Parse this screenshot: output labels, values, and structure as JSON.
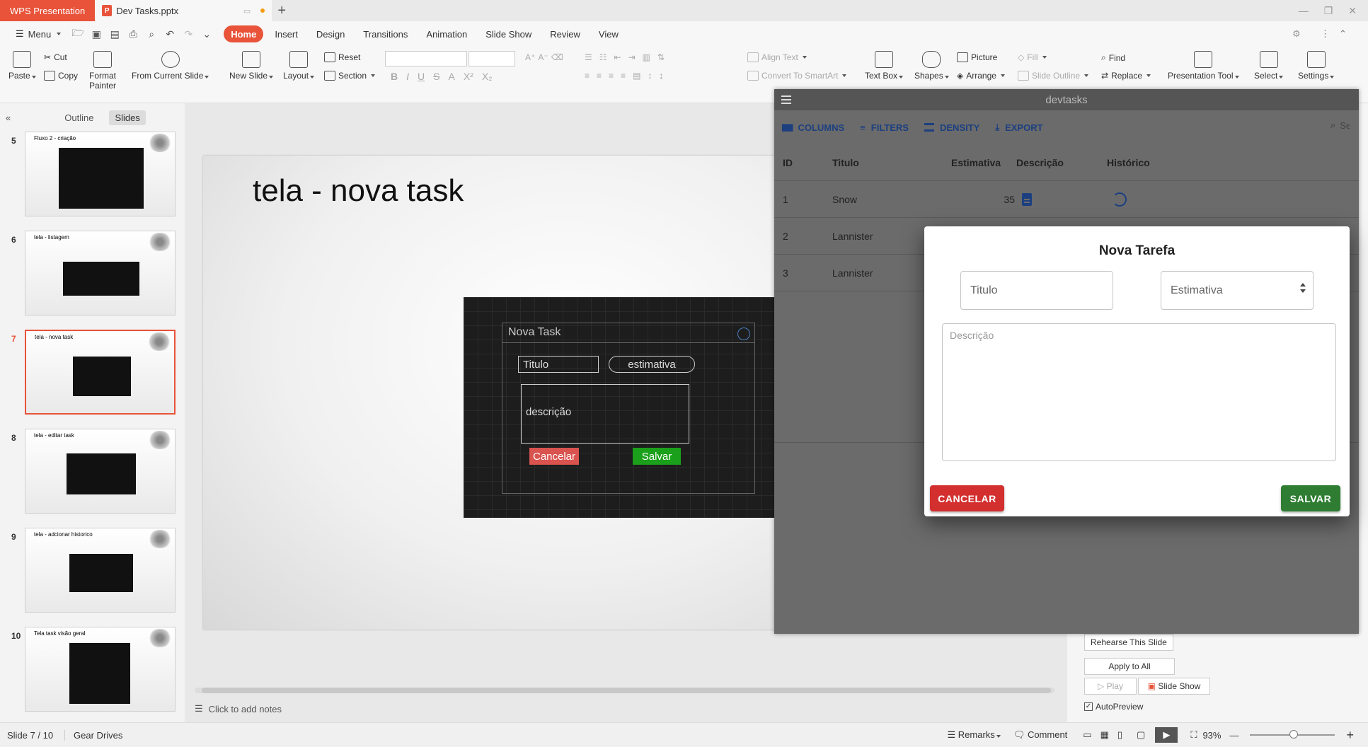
{
  "titlebar": {
    "app_name": "WPS Presentation",
    "doc_name": "Dev Tasks.pptx",
    "new_tab": "+"
  },
  "menubar": {
    "menu_label": "Menu",
    "tabs": [
      "Home",
      "Insert",
      "Design",
      "Transitions",
      "Animation",
      "Slide Show",
      "Review",
      "View"
    ]
  },
  "ribbon": {
    "paste": "Paste",
    "cut": "Cut",
    "copy": "Copy",
    "format_painter": "Format Painter",
    "from_current_slide": "From Current Slide",
    "new_slide": "New Slide",
    "layout": "Layout",
    "reset": "Reset",
    "section": "Section",
    "align_text": "Align Text",
    "convert_smartart": "Convert To SmartArt",
    "text_box": "Text Box",
    "shapes": "Shapes",
    "picture": "Picture",
    "fill": "Fill",
    "arrange": "Arrange",
    "slide_outline": "Slide Outline",
    "find": "Find",
    "replace": "Replace",
    "presentation_tool": "Presentation Tool",
    "select": "Select",
    "settings": "Settings"
  },
  "leftpanel": {
    "tab_outline": "Outline",
    "tab_slides": "Slides",
    "slides": [
      {
        "num": "5",
        "title": "Fluxo 2 - criação"
      },
      {
        "num": "6",
        "title": "tela - listagem"
      },
      {
        "num": "7",
        "title": "tela - nova task"
      },
      {
        "num": "8",
        "title": "tela - editar task"
      },
      {
        "num": "9",
        "title": "tela - adcionar historico"
      },
      {
        "num": "10",
        "title": "Tela task visão geral"
      }
    ]
  },
  "slide": {
    "title": "tela - nova task",
    "mock": {
      "header": "Nova Task",
      "titulo": "Titulo",
      "estimativa": "estimativa",
      "descricao": "descrição",
      "cancel": "Cancelar",
      "save": "Salvar"
    }
  },
  "notes": {
    "placeholder": "Click to add notes"
  },
  "rightpane": {
    "rehearse": "Rehearse This Slide",
    "apply_all": "Apply to All",
    "play": "Play",
    "slide_show": "Slide Show",
    "autopreview": "AutoPreview"
  },
  "statusbar": {
    "slide_pos": "Slide 7 / 10",
    "theme": "Gear Drives",
    "remarks": "Remarks",
    "comment": "Comment",
    "zoom": "93%"
  },
  "devtasks": {
    "title": "devtasks",
    "toolbar": [
      "COLUMNS",
      "FILTERS",
      "DENSITY",
      "EXPORT"
    ],
    "search_placeholder": "Sea",
    "columns": [
      "ID",
      "Titulo",
      "Estimativa",
      "Descrição",
      "Histórico"
    ],
    "rows": [
      {
        "id": "1",
        "titulo": "Snow",
        "estimativa": "35"
      },
      {
        "id": "2",
        "titulo": "Lannister",
        "estimativa": ""
      },
      {
        "id": "3",
        "titulo": "Lannister",
        "estimativa": ""
      }
    ]
  },
  "modal": {
    "title": "Nova Tarefa",
    "titulo_label": "Titulo",
    "estimativa_label": "Estimativa",
    "descricao_placeholder": "Descrição",
    "cancel": "CANCELAR",
    "save": "SALVAR"
  },
  "colors": {
    "accent": "#e8533a",
    "dev_primary": "#1c3f80",
    "cancel_red": "#d32f2f",
    "save_green": "#2e7d32"
  }
}
